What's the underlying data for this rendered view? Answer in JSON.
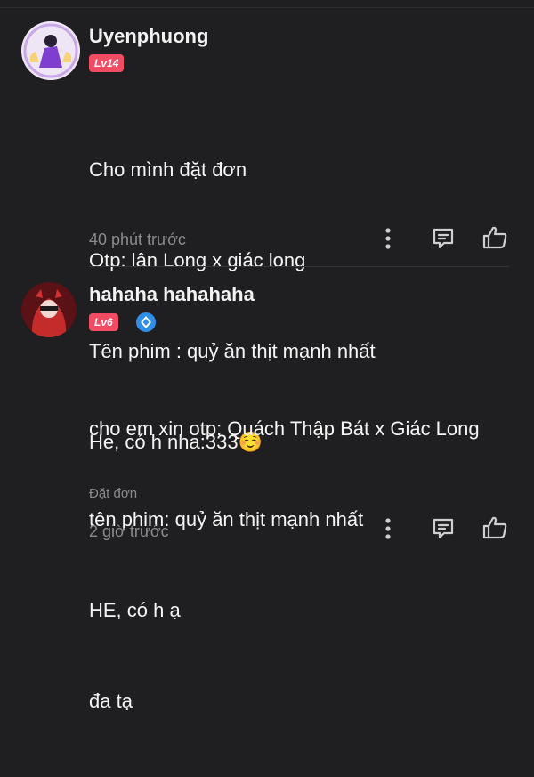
{
  "comments": [
    {
      "username": "Uyenphuong",
      "level": "Lv14",
      "lines": [
        "Cho mình đặt đơn",
        "Otp: lân Long x giác long",
        "Tên phim : quỷ ăn thịt mạnh nhất",
        "He, có h nha:333☺️"
      ],
      "time": "40 phút trước",
      "icons": {
        "more": "more-vertical-icon",
        "reply": "reply-icon",
        "like": "thumbs-up-icon"
      }
    },
    {
      "username": "hahaha hahahaha",
      "level": "Lv6",
      "verified_icon": "diamond-badge-icon",
      "lines": [
        "cho em xin otp: Quách Thập Bát x Giác Long",
        "tên phim: quỷ ăn thịt mạnh nhất",
        "HE, có h ạ",
        "đa tạ"
      ],
      "tag": "Đặt đơn",
      "time": "2 giờ trước",
      "icons": {
        "more": "more-vertical-icon",
        "reply": "reply-icon",
        "like": "thumbs-up-icon"
      }
    }
  ],
  "colors": {
    "background": "#1f1f21",
    "level_badge": "#f24c64",
    "muted_text": "#8b8b8f",
    "vip_badge": "#2e8ee8"
  }
}
